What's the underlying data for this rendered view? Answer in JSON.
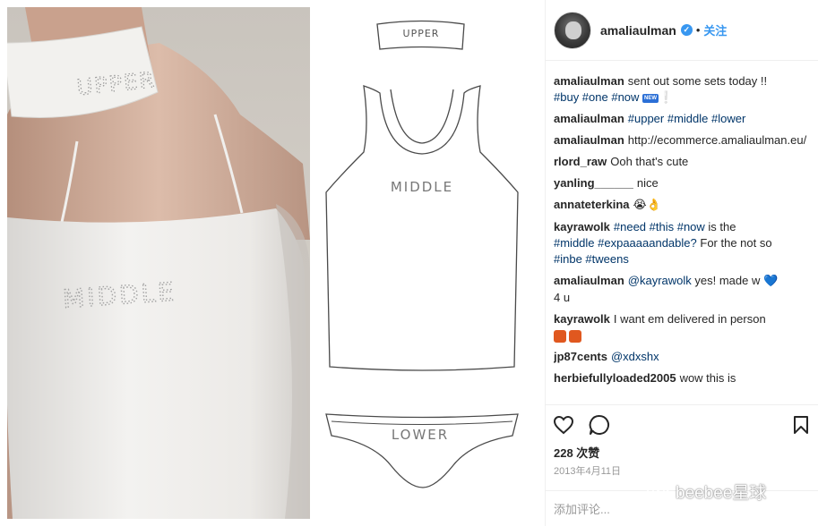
{
  "photo": {
    "choker_text": "UPPER",
    "tank_text": "MIDDLE"
  },
  "diagram": {
    "upper_label": "UPPER",
    "middle_label": "MIDDLE",
    "lower_label": "LOWER"
  },
  "header": {
    "username": "amaliaulman",
    "follow_label": "关注"
  },
  "comments": [
    {
      "user": "amaliaulman",
      "text_a": "sent out some sets today !!",
      "tags_a": "#buy #one #now",
      "badge": "NEW",
      "tail": "❕"
    },
    {
      "user": "amaliaulman",
      "tags": "#upper #middle #lower"
    },
    {
      "user": "amaliaulman",
      "text": "http://ecommerce.amaliaulman.eu/"
    },
    {
      "user": "rlord_raw",
      "text": "Ooh that's cute"
    },
    {
      "user": "yanling______",
      "text": "nice"
    },
    {
      "user": "annateterkina",
      "emoji": "😭👌"
    },
    {
      "user": "kayrawolk",
      "t1": "#need #this #now",
      "t2": "is the",
      "t3": "#middle #expaaaaandable?",
      "t4": "For the not so",
      "t5": "#inbe #tweens"
    },
    {
      "user": "amaliaulman",
      "mention": "@kayrawolk",
      "text": "yes! made w",
      "heart": "💙",
      "text2": "4 u"
    },
    {
      "user": "kayrawolk",
      "text": "I want em delivered in person"
    },
    {
      "user": "jp87cents",
      "mention": "@xdxshx"
    },
    {
      "user": "herbiefullyloaded2005",
      "text": "wow this is"
    }
  ],
  "likes": "228 次赞",
  "date": "2013年4月11日",
  "add_comment_placeholder": "添加评论...",
  "watermark": "beebee星球",
  "icons": {
    "like": "heart-icon",
    "comment": "comment-icon",
    "save": "bookmark-icon",
    "verified": "verified-icon"
  },
  "colors": {
    "link": "#003569",
    "follow": "#3897f0",
    "verified": "#3897f0",
    "muted": "#999999"
  }
}
